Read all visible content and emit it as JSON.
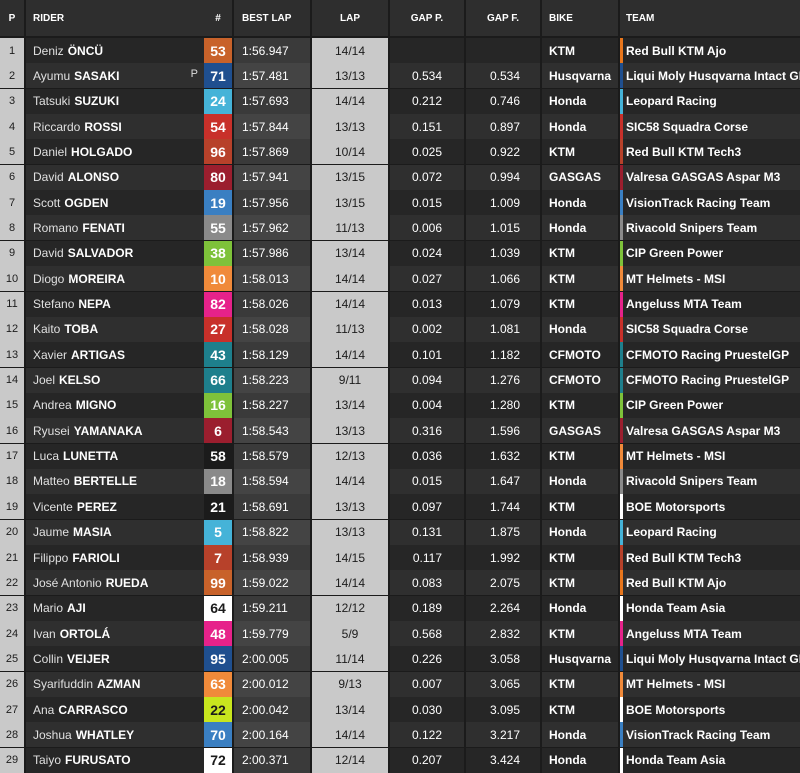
{
  "header": {
    "pos": "P",
    "rider": "RIDER",
    "num": "#",
    "best_lap": "BEST LAP",
    "lap": "LAP",
    "gap_p": "GAP P.",
    "gap_f": "GAP F.",
    "bike": "BIKE",
    "team": "TEAM"
  },
  "rows": [
    {
      "pos": "1",
      "first": "Deniz",
      "last": "ÖNCÜ",
      "pole": "",
      "num": "53",
      "num_bg": "#c8622a",
      "num_fg": "#ffffff",
      "best": "1:56.947",
      "lap": "14/14",
      "gap_p": "",
      "gap_f": "",
      "bike": "KTM",
      "team": "Red Bull KTM Ajo",
      "team_color": "#e8761c"
    },
    {
      "pos": "2",
      "first": "Ayumu",
      "last": "SASAKI",
      "pole": "P",
      "num": "71",
      "num_bg": "#1f4f8f",
      "num_fg": "#ffffff",
      "best": "1:57.481",
      "lap": "13/13",
      "gap_p": "0.534",
      "gap_f": "0.534",
      "bike": "Husqvarna",
      "team": "Liqui Moly Husqvarna Intact GP",
      "team_color": "#1f4f8f"
    },
    {
      "pos": "3",
      "first": "Tatsuki",
      "last": "SUZUKI",
      "pole": "",
      "num": "24",
      "num_bg": "#45b3d8",
      "num_fg": "#ffffff",
      "best": "1:57.693",
      "lap": "14/14",
      "gap_p": "0.212",
      "gap_f": "0.746",
      "bike": "Honda",
      "team": "Leopard Racing",
      "team_color": "#45b3d8"
    },
    {
      "pos": "4",
      "first": "Riccardo",
      "last": "ROSSI",
      "pole": "",
      "num": "54",
      "num_bg": "#c8302a",
      "num_fg": "#ffffff",
      "best": "1:57.844",
      "lap": "13/13",
      "gap_p": "0.151",
      "gap_f": "0.897",
      "bike": "Honda",
      "team": "SIC58 Squadra Corse",
      "team_color": "#c8302a"
    },
    {
      "pos": "5",
      "first": "Daniel",
      "last": "HOLGADO",
      "pole": "",
      "num": "96",
      "num_bg": "#b7412a",
      "num_fg": "#ffffff",
      "best": "1:57.869",
      "lap": "10/14",
      "gap_p": "0.025",
      "gap_f": "0.922",
      "bike": "KTM",
      "team": "Red Bull KTM Tech3",
      "team_color": "#b7412a"
    },
    {
      "pos": "6",
      "first": "David",
      "last": "ALONSO",
      "pole": "",
      "num": "80",
      "num_bg": "#9b1e2e",
      "num_fg": "#ffffff",
      "best": "1:57.941",
      "lap": "13/15",
      "gap_p": "0.072",
      "gap_f": "0.994",
      "bike": "GASGAS",
      "team": "Valresa GASGAS Aspar M3",
      "team_color": "#9b1e2e"
    },
    {
      "pos": "7",
      "first": "Scott",
      "last": "OGDEN",
      "pole": "",
      "num": "19",
      "num_bg": "#3a7fc2",
      "num_fg": "#ffffff",
      "best": "1:57.956",
      "lap": "13/15",
      "gap_p": "0.015",
      "gap_f": "1.009",
      "bike": "Honda",
      "team": "VisionTrack Racing Team",
      "team_color": "#3a7fc2"
    },
    {
      "pos": "8",
      "first": "Romano",
      "last": "FENATI",
      "pole": "",
      "num": "55",
      "num_bg": "#8a8a8a",
      "num_fg": "#ffffff",
      "best": "1:57.962",
      "lap": "11/13",
      "gap_p": "0.006",
      "gap_f": "1.015",
      "bike": "Honda",
      "team": "Rivacold Snipers Team",
      "team_color": "#8a8a8a"
    },
    {
      "pos": "9",
      "first": "David",
      "last": "SALVADOR",
      "pole": "",
      "num": "38",
      "num_bg": "#7ec23a",
      "num_fg": "#ffffff",
      "best": "1:57.986",
      "lap": "13/14",
      "gap_p": "0.024",
      "gap_f": "1.039",
      "bike": "KTM",
      "team": "CIP Green Power",
      "team_color": "#7ec23a"
    },
    {
      "pos": "10",
      "first": "Diogo",
      "last": "MOREIRA",
      "pole": "",
      "num": "10",
      "num_bg": "#f08a3a",
      "num_fg": "#ffffff",
      "best": "1:58.013",
      "lap": "14/14",
      "gap_p": "0.027",
      "gap_f": "1.066",
      "bike": "KTM",
      "team": "MT Helmets - MSI",
      "team_color": "#f08a3a"
    },
    {
      "pos": "11",
      "first": "Stefano",
      "last": "NEPA",
      "pole": "",
      "num": "82",
      "num_bg": "#e6228a",
      "num_fg": "#ffffff",
      "best": "1:58.026",
      "lap": "14/14",
      "gap_p": "0.013",
      "gap_f": "1.079",
      "bike": "KTM",
      "team": "Angeluss MTA Team",
      "team_color": "#e6228a"
    },
    {
      "pos": "12",
      "first": "Kaito",
      "last": "TOBA",
      "pole": "",
      "num": "27",
      "num_bg": "#c8302a",
      "num_fg": "#ffffff",
      "best": "1:58.028",
      "lap": "11/13",
      "gap_p": "0.002",
      "gap_f": "1.081",
      "bike": "Honda",
      "team": "SIC58 Squadra Corse",
      "team_color": "#c8302a"
    },
    {
      "pos": "13",
      "first": "Xavier",
      "last": "ARTIGAS",
      "pole": "",
      "num": "43",
      "num_bg": "#1e7f8c",
      "num_fg": "#ffffff",
      "best": "1:58.129",
      "lap": "14/14",
      "gap_p": "0.101",
      "gap_f": "1.182",
      "bike": "CFMOTO",
      "team": "CFMOTO Racing PruestelGP",
      "team_color": "#1e7f8c"
    },
    {
      "pos": "14",
      "first": "Joel",
      "last": "KELSO",
      "pole": "",
      "num": "66",
      "num_bg": "#1e7f8c",
      "num_fg": "#ffffff",
      "best": "1:58.223",
      "lap": "9/11",
      "gap_p": "0.094",
      "gap_f": "1.276",
      "bike": "CFMOTO",
      "team": "CFMOTO Racing PruestelGP",
      "team_color": "#1e7f8c"
    },
    {
      "pos": "15",
      "first": "Andrea",
      "last": "MIGNO",
      "pole": "",
      "num": "16",
      "num_bg": "#7ec23a",
      "num_fg": "#ffffff",
      "best": "1:58.227",
      "lap": "13/14",
      "gap_p": "0.004",
      "gap_f": "1.280",
      "bike": "KTM",
      "team": "CIP Green Power",
      "team_color": "#7ec23a"
    },
    {
      "pos": "16",
      "first": "Ryusei",
      "last": "YAMANAKA",
      "pole": "",
      "num": "6",
      "num_bg": "#9b1e2e",
      "num_fg": "#ffffff",
      "best": "1:58.543",
      "lap": "13/13",
      "gap_p": "0.316",
      "gap_f": "1.596",
      "bike": "GASGAS",
      "team": "Valresa GASGAS Aspar M3",
      "team_color": "#9b1e2e"
    },
    {
      "pos": "17",
      "first": "Luca",
      "last": "LUNETTA",
      "pole": "",
      "num": "58",
      "num_bg": "#1b1b1b",
      "num_fg": "#ffffff",
      "best": "1:58.579",
      "lap": "12/13",
      "gap_p": "0.036",
      "gap_f": "1.632",
      "bike": "KTM",
      "team": "MT Helmets - MSI",
      "team_color": "#f08a3a"
    },
    {
      "pos": "18",
      "first": "Matteo",
      "last": "BERTELLE",
      "pole": "",
      "num": "18",
      "num_bg": "#8a8a8a",
      "num_fg": "#ffffff",
      "best": "1:58.594",
      "lap": "14/14",
      "gap_p": "0.015",
      "gap_f": "1.647",
      "bike": "Honda",
      "team": "Rivacold Snipers Team",
      "team_color": "#8a8a8a"
    },
    {
      "pos": "19",
      "first": "Vicente",
      "last": "PEREZ",
      "pole": "",
      "num": "21",
      "num_bg": "#1b1b1b",
      "num_fg": "#ffffff",
      "best": "1:58.691",
      "lap": "13/13",
      "gap_p": "0.097",
      "gap_f": "1.744",
      "bike": "KTM",
      "team": "BOE Motorsports",
      "team_color": "#ffffff"
    },
    {
      "pos": "20",
      "first": "Jaume",
      "last": "MASIA",
      "pole": "",
      "num": "5",
      "num_bg": "#45b3d8",
      "num_fg": "#ffffff",
      "best": "1:58.822",
      "lap": "13/13",
      "gap_p": "0.131",
      "gap_f": "1.875",
      "bike": "Honda",
      "team": "Leopard Racing",
      "team_color": "#45b3d8"
    },
    {
      "pos": "21",
      "first": "Filippo",
      "last": "FARIOLI",
      "pole": "",
      "num": "7",
      "num_bg": "#b7412a",
      "num_fg": "#ffffff",
      "best": "1:58.939",
      "lap": "14/15",
      "gap_p": "0.117",
      "gap_f": "1.992",
      "bike": "KTM",
      "team": "Red Bull KTM Tech3",
      "team_color": "#b7412a"
    },
    {
      "pos": "22",
      "first": "José Antonio",
      "last": "RUEDA",
      "pole": "",
      "num": "99",
      "num_bg": "#c8622a",
      "num_fg": "#ffffff",
      "best": "1:59.022",
      "lap": "14/14",
      "gap_p": "0.083",
      "gap_f": "2.075",
      "bike": "KTM",
      "team": "Red Bull KTM Ajo",
      "team_color": "#e8761c"
    },
    {
      "pos": "23",
      "first": "Mario",
      "last": "AJI",
      "pole": "",
      "num": "64",
      "num_bg": "#ffffff",
      "num_fg": "#1b1b1b",
      "best": "1:59.211",
      "lap": "12/12",
      "gap_p": "0.189",
      "gap_f": "2.264",
      "bike": "Honda",
      "team": "Honda Team Asia",
      "team_color": "#ffffff"
    },
    {
      "pos": "24",
      "first": "Ivan",
      "last": "ORTOLÁ",
      "pole": "",
      "num": "48",
      "num_bg": "#e6228a",
      "num_fg": "#ffffff",
      "best": "1:59.779",
      "lap": "5/9",
      "gap_p": "0.568",
      "gap_f": "2.832",
      "bike": "KTM",
      "team": "Angeluss MTA Team",
      "team_color": "#e6228a"
    },
    {
      "pos": "25",
      "first": "Collin",
      "last": "VEIJER",
      "pole": "",
      "num": "95",
      "num_bg": "#1f4f8f",
      "num_fg": "#ffffff",
      "best": "2:00.005",
      "lap": "11/14",
      "gap_p": "0.226",
      "gap_f": "3.058",
      "bike": "Husqvarna",
      "team": "Liqui Moly Husqvarna Intact GP",
      "team_color": "#1f4f8f"
    },
    {
      "pos": "26",
      "first": "Syarifuddin",
      "last": "AZMAN",
      "pole": "",
      "num": "63",
      "num_bg": "#f08a3a",
      "num_fg": "#ffffff",
      "best": "2:00.012",
      "lap": "9/13",
      "gap_p": "0.007",
      "gap_f": "3.065",
      "bike": "KTM",
      "team": "MT Helmets - MSI",
      "team_color": "#f08a3a"
    },
    {
      "pos": "27",
      "first": "Ana",
      "last": "CARRASCO",
      "pole": "",
      "num": "22",
      "num_bg": "#c8e61e",
      "num_fg": "#1b1b1b",
      "best": "2:00.042",
      "lap": "13/14",
      "gap_p": "0.030",
      "gap_f": "3.095",
      "bike": "KTM",
      "team": "BOE Motorsports",
      "team_color": "#ffffff"
    },
    {
      "pos": "28",
      "first": "Joshua",
      "last": "WHATLEY",
      "pole": "",
      "num": "70",
      "num_bg": "#3a7fc2",
      "num_fg": "#ffffff",
      "best": "2:00.164",
      "lap": "14/14",
      "gap_p": "0.122",
      "gap_f": "3.217",
      "bike": "Honda",
      "team": "VisionTrack Racing Team",
      "team_color": "#3a7fc2"
    },
    {
      "pos": "29",
      "first": "Taiyo",
      "last": "FURUSATO",
      "pole": "",
      "num": "72",
      "num_bg": "#ffffff",
      "num_fg": "#1b1b1b",
      "best": "2:00.371",
      "lap": "12/14",
      "gap_p": "0.207",
      "gap_f": "3.424",
      "bike": "Honda",
      "team": "Honda Team Asia",
      "team_color": "#ffffff"
    }
  ]
}
